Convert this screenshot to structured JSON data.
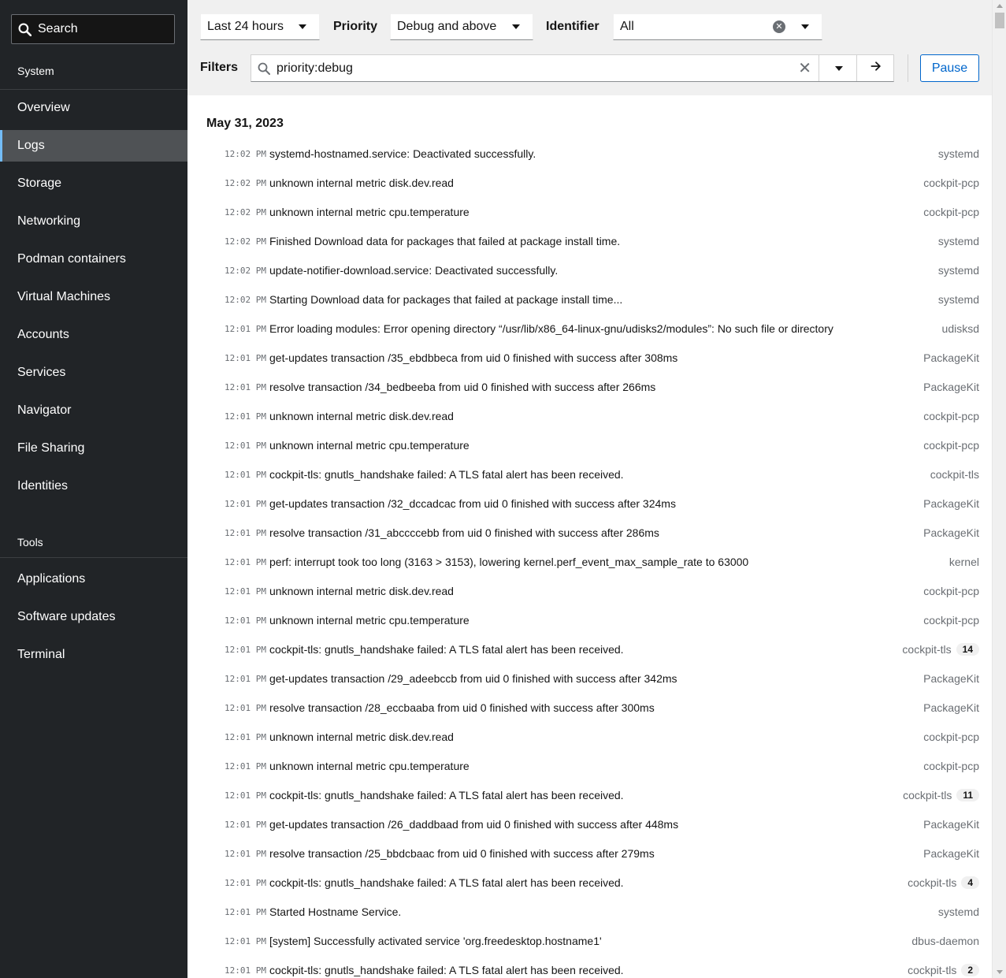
{
  "sidebar": {
    "search_label": "Search",
    "section_system": "System",
    "items_system": [
      {
        "label": "Overview",
        "name": "overview"
      },
      {
        "label": "Logs",
        "name": "logs",
        "active": true
      },
      {
        "label": "Storage",
        "name": "storage"
      },
      {
        "label": "Networking",
        "name": "networking"
      },
      {
        "label": "Podman containers",
        "name": "podman-containers"
      },
      {
        "label": "Virtual Machines",
        "name": "virtual-machines"
      },
      {
        "label": "Accounts",
        "name": "accounts"
      },
      {
        "label": "Services",
        "name": "services"
      },
      {
        "label": "Navigator",
        "name": "navigator"
      },
      {
        "label": "File Sharing",
        "name": "file-sharing"
      },
      {
        "label": "Identities",
        "name": "identities"
      }
    ],
    "section_tools": "Tools",
    "items_tools": [
      {
        "label": "Applications",
        "name": "applications"
      },
      {
        "label": "Software updates",
        "name": "software-updates"
      },
      {
        "label": "Terminal",
        "name": "terminal"
      }
    ]
  },
  "toolbar": {
    "time_range": "Last 24 hours",
    "priority_label": "Priority",
    "priority_value": "Debug and above",
    "identifier_label": "Identifier",
    "identifier_value": "All",
    "filters_label": "Filters",
    "filter_value": "priority:debug",
    "pause_label": "Pause"
  },
  "log": {
    "date": "May 31, 2023",
    "entries": [
      {
        "time": "12:02 PM",
        "message": "systemd-hostnamed.service: Deactivated successfully.",
        "identifier": "systemd",
        "count": ""
      },
      {
        "time": "12:02 PM",
        "message": "unknown internal metric disk.dev.read",
        "identifier": "cockpit-pcp",
        "count": ""
      },
      {
        "time": "12:02 PM",
        "message": "unknown internal metric cpu.temperature",
        "identifier": "cockpit-pcp",
        "count": ""
      },
      {
        "time": "12:02 PM",
        "message": "Finished Download data for packages that failed at package install time.",
        "identifier": "systemd",
        "count": ""
      },
      {
        "time": "12:02 PM",
        "message": "update-notifier-download.service: Deactivated successfully.",
        "identifier": "systemd",
        "count": ""
      },
      {
        "time": "12:02 PM",
        "message": "Starting Download data for packages that failed at package install time...",
        "identifier": "systemd",
        "count": ""
      },
      {
        "time": "12:01 PM",
        "message": "Error loading modules: Error opening directory “/usr/lib/x86_64-linux-gnu/udisks2/modules”: No such file or directory",
        "identifier": "udisksd",
        "count": ""
      },
      {
        "time": "12:01 PM",
        "message": "get-updates transaction /35_ebdbbeca from uid 0 finished with success after 308ms",
        "identifier": "PackageKit",
        "count": ""
      },
      {
        "time": "12:01 PM",
        "message": "resolve transaction /34_bedbeeba from uid 0 finished with success after 266ms",
        "identifier": "PackageKit",
        "count": ""
      },
      {
        "time": "12:01 PM",
        "message": "unknown internal metric disk.dev.read",
        "identifier": "cockpit-pcp",
        "count": ""
      },
      {
        "time": "12:01 PM",
        "message": "unknown internal metric cpu.temperature",
        "identifier": "cockpit-pcp",
        "count": ""
      },
      {
        "time": "12:01 PM",
        "message": "cockpit-tls: gnutls_handshake failed: A TLS fatal alert has been received.",
        "identifier": "cockpit-tls",
        "count": ""
      },
      {
        "time": "12:01 PM",
        "message": "get-updates transaction /32_dccadcac from uid 0 finished with success after 324ms",
        "identifier": "PackageKit",
        "count": ""
      },
      {
        "time": "12:01 PM",
        "message": "resolve transaction /31_abccccebb from uid 0 finished with success after 286ms",
        "identifier": "PackageKit",
        "count": ""
      },
      {
        "time": "12:01 PM",
        "message": "perf: interrupt took too long (3163 > 3153), lowering kernel.perf_event_max_sample_rate to 63000",
        "identifier": "kernel",
        "count": ""
      },
      {
        "time": "12:01 PM",
        "message": "unknown internal metric disk.dev.read",
        "identifier": "cockpit-pcp",
        "count": ""
      },
      {
        "time": "12:01 PM",
        "message": "unknown internal metric cpu.temperature",
        "identifier": "cockpit-pcp",
        "count": ""
      },
      {
        "time": "12:01 PM",
        "message": "cockpit-tls: gnutls_handshake failed: A TLS fatal alert has been received.",
        "identifier": "cockpit-tls",
        "count": "14"
      },
      {
        "time": "12:01 PM",
        "message": "get-updates transaction /29_adeebccb from uid 0 finished with success after 342ms",
        "identifier": "PackageKit",
        "count": ""
      },
      {
        "time": "12:01 PM",
        "message": "resolve transaction /28_eccbaaba from uid 0 finished with success after 300ms",
        "identifier": "PackageKit",
        "count": ""
      },
      {
        "time": "12:01 PM",
        "message": "unknown internal metric disk.dev.read",
        "identifier": "cockpit-pcp",
        "count": ""
      },
      {
        "time": "12:01 PM",
        "message": "unknown internal metric cpu.temperature",
        "identifier": "cockpit-pcp",
        "count": ""
      },
      {
        "time": "12:01 PM",
        "message": "cockpit-tls: gnutls_handshake failed: A TLS fatal alert has been received.",
        "identifier": "cockpit-tls",
        "count": "11"
      },
      {
        "time": "12:01 PM",
        "message": "get-updates transaction /26_daddbaad from uid 0 finished with success after 448ms",
        "identifier": "PackageKit",
        "count": ""
      },
      {
        "time": "12:01 PM",
        "message": "resolve transaction /25_bbdcbaac from uid 0 finished with success after 279ms",
        "identifier": "PackageKit",
        "count": ""
      },
      {
        "time": "12:01 PM",
        "message": "cockpit-tls: gnutls_handshake failed: A TLS fatal alert has been received.",
        "identifier": "cockpit-tls",
        "count": "4"
      },
      {
        "time": "12:01 PM",
        "message": "Started Hostname Service.",
        "identifier": "systemd",
        "count": ""
      },
      {
        "time": "12:01 PM",
        "message": "[system] Successfully activated service 'org.freedesktop.hostname1'",
        "identifier": "dbus-daemon",
        "count": ""
      },
      {
        "time": "12:01 PM",
        "message": "cockpit-tls: gnutls_handshake failed: A TLS fatal alert has been received.",
        "identifier": "cockpit-tls",
        "count": "2"
      }
    ]
  }
}
